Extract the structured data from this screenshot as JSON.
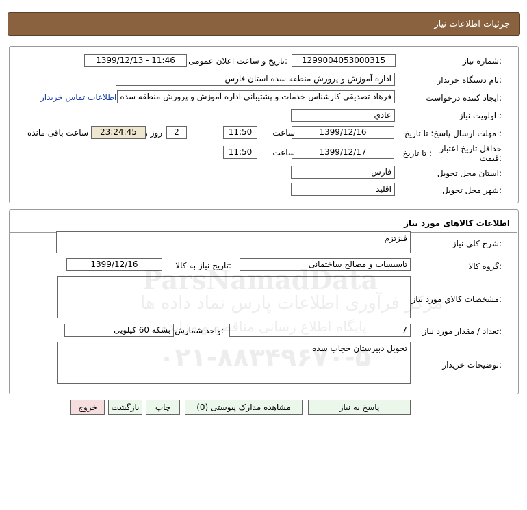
{
  "header": {
    "title": "جزئیات اطلاعات نیاز"
  },
  "need_info": {
    "need_number_label": "شماره نیاز:",
    "need_number": "1299004053000315",
    "announce_label": "تاریخ و ساعت اعلان عمومی:",
    "announce_value": "1399/12/13 - 11:46",
    "buyer_org_label": "نام دستگاه خریدار:",
    "buyer_org": "اداره آموزش و پرورش منطقه سده استان فارس",
    "requester_label": "ایجاد کننده درخواست:",
    "requester": "فرهاد تصدیقی کارشناس خدمات و پشتیبانی اداره آموزش و پرورش منطقه سده",
    "contact_link": "اطلاعات تماس خریدار",
    "priority_label": "اولویت نیاز :",
    "priority": "عادي",
    "reply_deadline_label": "مهلت ارسال پاسخ:  تا تاریخ :",
    "reply_date": "1399/12/16",
    "time_label": "ساعت",
    "reply_time": "11:50",
    "days": "2",
    "days_label": "روز و",
    "remaining_time": "23:24:45",
    "remaining_label": "ساعت باقی مانده",
    "price_validity_label": "حداقل تاریخ اعتبار قیمت:",
    "to_date_label": "تا تاریخ :",
    "validity_date": "1399/12/17",
    "validity_time_label": "ساعت",
    "validity_time": "11:50",
    "province_label": "استان محل تحویل:",
    "province": "فارس",
    "city_label": "شهر محل تحویل:",
    "city": "اقلید"
  },
  "goods": {
    "section_title": "اطلاعات کالاهای مورد نیاز",
    "general_desc_label": "شرح کلی نیاز:",
    "general_desc": "فیزتزم",
    "group_label": "گروه کالا:",
    "group": "تاسیسات و مصالح ساختمانی",
    "need_date_label": "تاریخ نیاز به کالا:",
    "need_date": "1399/12/16",
    "specs_label": "مشخصات کالاي مورد نیاز:",
    "specs": "",
    "quantity_label": "تعداد / مقدار مورد نیاز:",
    "quantity": "7",
    "unit_label": "واحد شمارش:",
    "unit": "بشکه 60 کیلویی",
    "buyer_notes_label": "توضیحات خریدار:",
    "buyer_notes": "تحویل دبیرستان حجاب سده"
  },
  "buttons": {
    "reply": "پاسخ به نیاز",
    "attachments": "مشاهده مدارک پیوستی (0)",
    "print": "چاپ",
    "back": "بازگشت",
    "exit": "خروج"
  },
  "watermark": {
    "brand": "ParsNamadData",
    "line1": "مرکز فرآوری اطلاعات پارس نماد داده ها",
    "line2": "پایگاه اطلاع رسانی مناقصه و مزایده",
    "phone": "۰۲۱-۸۸۳۴۹۶۷۰-۵"
  }
}
